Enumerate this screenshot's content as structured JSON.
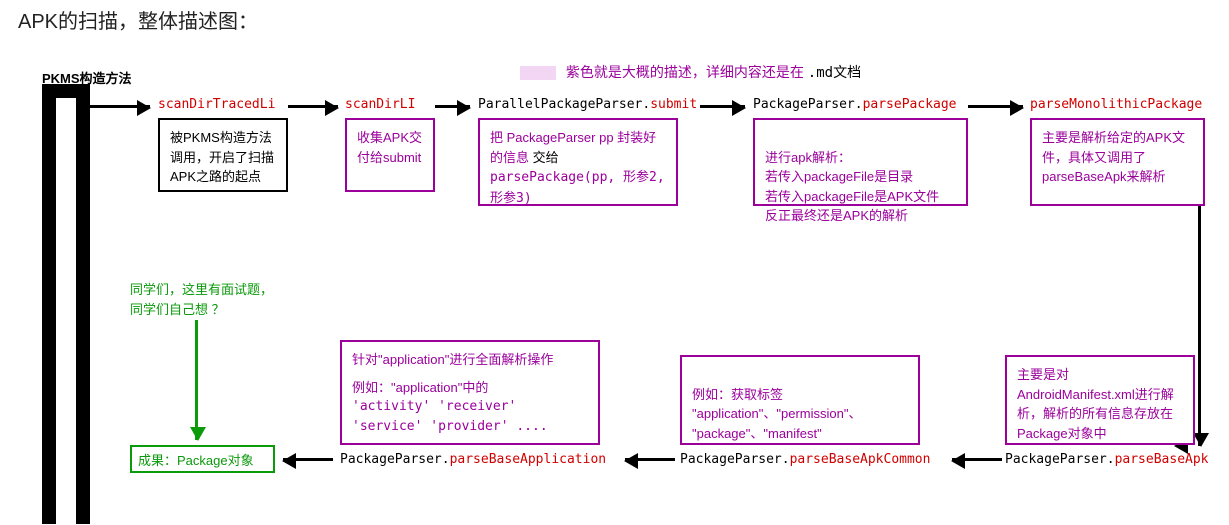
{
  "title": "APK的扫描，整体描述图：",
  "pkms_label": "PKMS构造方法",
  "legend": {
    "text_purple": "紫色就是大概的描述，详细内容还是在 ",
    "md": ".md文档"
  },
  "top_row": {
    "m1": "scanDirTracedLi",
    "b1": "被PKMS构造方法调用，开启了扫描APK之路的起点",
    "m2": "scanDirLI",
    "b2": "收集APK交付给submit",
    "m3_black": "ParallelPackageParser.",
    "m3_red": "submit",
    "b3_l1": "把 PackageParser pp 封装好的信息 ",
    "b3_l1b": "交给",
    "b3_l2": "parsePackage(pp, 形参2, 形参3)",
    "m4_black": "PackageParser.",
    "m4_red": "parsePackage",
    "b4": "进行apk解析：\n若传入packageFile是目录\n若传入packageFile是APK文件\n反正最终还是APK的解析",
    "m5": "parseMonolithicPackage",
    "b5": "主要是解析给定的APK文件，具体又调用了parseBaseApk来解析"
  },
  "bottom_row": {
    "m6_black": "PackageParser.",
    "m6_red": "parseBaseApk",
    "b6": "主要是对AndroidManifest.xml进行解析，解析的所有信息存放在Package对象中",
    "m7_black": "PackageParser.",
    "m7_red": "parseBaseApkCommon",
    "b7": "例如：获取标签\n\"application\"、\"permission\"、\n\"package\"、\"manifest\"",
    "m8_black": "PackageParser.",
    "m8_red": "parseBaseApplication",
    "b8_l1": "针对\"application\"进行全面解析操作",
    "b8_l2": "例如：\"application\"中的",
    "b8_l3": "  'activity'  'receiver'",
    "b8_l4": "  'service'  'provider' ....",
    "result": "成果：Package对象"
  },
  "green_note": {
    "l1": "同学们，这里有面试题，",
    "l2": "同学们自己想 ？"
  }
}
